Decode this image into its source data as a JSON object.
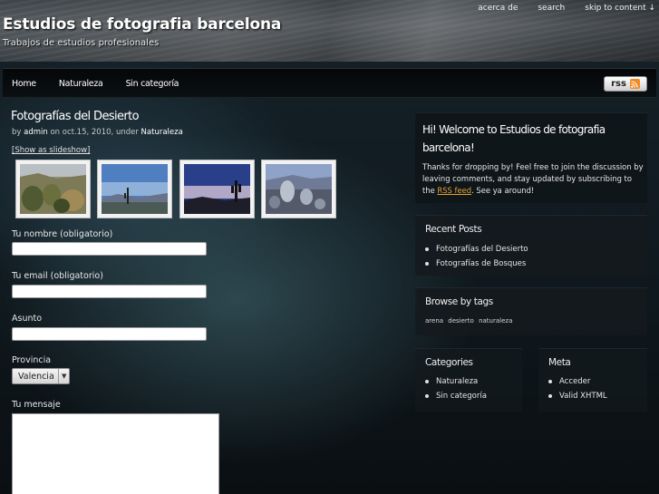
{
  "header": {
    "title": "Estudios de fotografia barcelona",
    "tagline": "Trabajos de estudios profesionales",
    "top_links": [
      "acerca de",
      "search",
      "skip to content ↓"
    ]
  },
  "nav": {
    "items": [
      "Home",
      "Naturaleza",
      "Sin categoría"
    ],
    "rss_label": "rss"
  },
  "post": {
    "title": "Fotografías del Desierto",
    "meta_by": "by",
    "author": "admin",
    "meta_on": "on oct.15, 2010, under",
    "category": "Naturaleza",
    "slideshow_link": "[Show as slideshow]",
    "thumbnail_count": 4
  },
  "form": {
    "name_label": "Tu nombre (obligatorio)",
    "email_label": "Tu email (obligatorio)",
    "subject_label": "Asunto",
    "province_label": "Provincia",
    "province_value": "Valencia",
    "message_label": "Tu mensaje"
  },
  "sidebar": {
    "welcome_title": "Hi! Welcome to Estudios de fotografia barcelona!",
    "welcome_text_before": "Thanks for dropping by! Feel free to join the discussion by leaving comments, and stay updated by subscribing to the",
    "welcome_link": "RSS feed",
    "welcome_text_after": ". See ya around!",
    "recent_title": "Recent Posts",
    "recent_posts": [
      "Fotografías del Desierto",
      "Fotografías de Bosques"
    ],
    "tags_title": "Browse by tags",
    "tags": [
      "arena",
      "desierto",
      "naturaleza"
    ],
    "categories_title": "Categories",
    "categories": [
      "Naturaleza",
      "Sin categoría"
    ],
    "meta_title": "Meta",
    "meta_links": [
      "Acceder",
      "Valid XHTML"
    ]
  },
  "colors": {
    "link_accent": "#e8a035",
    "rss_icon": "#f08a24"
  }
}
